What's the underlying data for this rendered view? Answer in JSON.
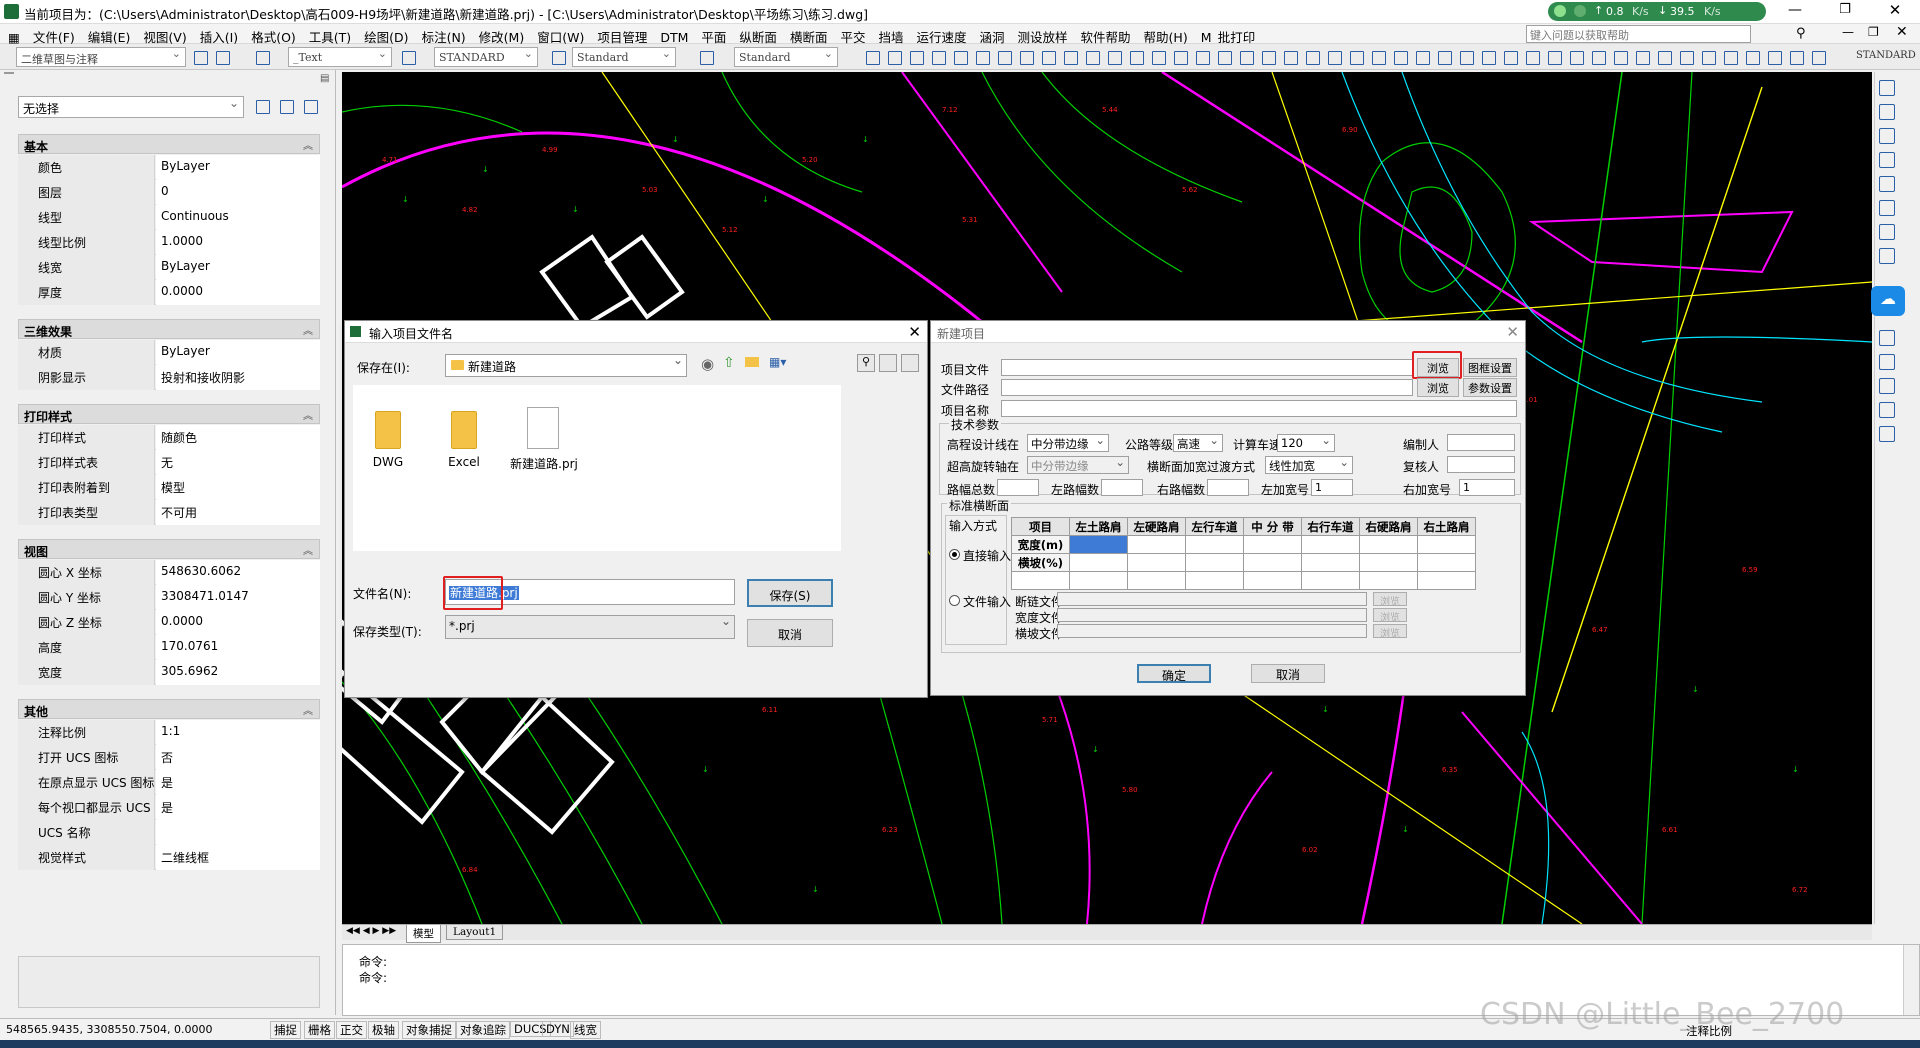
{
  "window": {
    "title": "当前项目为：(C:\\Users\\Administrator\\Desktop\\高石009-H9场坪\\新建道路\\新建道路.prj) - [C:\\Users\\Administrator\\Desktop\\平场练习\\练习.dwg]",
    "net_up": "0.8",
    "net_up_unit": "K/s",
    "net_down": "39.5",
    "net_down_unit": "K/s",
    "help_search_placeholder": "键入问题以获取帮助"
  },
  "menu": [
    "文件(F)",
    "编辑(E)",
    "视图(V)",
    "插入(I)",
    "格式(O)",
    "工具(T)",
    "绘图(D)",
    "标注(N)",
    "修改(M)",
    "窗口(W)",
    "项目管理",
    "DTM",
    "平面",
    "纵断面",
    "横断面",
    "平交",
    "挡墙",
    "运行速度",
    "涵洞",
    "测设放样",
    "软件帮助",
    "帮助(H)",
    "M_批打印"
  ],
  "toolbar": {
    "workspace": "二维草图与注释",
    "text_style": "_Text",
    "dim_style": "STANDARD",
    "table_style": "Standard",
    "multileader_style": "Standard",
    "right_style": "STANDARD"
  },
  "properties": {
    "selection": "无选择",
    "sections": [
      {
        "title": "基本",
        "rows": [
          [
            "颜色",
            "ByLayer"
          ],
          [
            "图层",
            "0"
          ],
          [
            "线型",
            "Continuous"
          ],
          [
            "线型比例",
            "1.0000"
          ],
          [
            "线宽",
            "ByLayer"
          ],
          [
            "厚度",
            "0.0000"
          ]
        ]
      },
      {
        "title": "三维效果",
        "rows": [
          [
            "材质",
            "ByLayer"
          ],
          [
            "阴影显示",
            "投射和接收阴影"
          ]
        ]
      },
      {
        "title": "打印样式",
        "rows": [
          [
            "打印样式",
            "随颜色"
          ],
          [
            "打印样式表",
            "无"
          ],
          [
            "打印表附着到",
            "模型"
          ],
          [
            "打印表类型",
            "不可用"
          ]
        ]
      },
      {
        "title": "视图",
        "rows": [
          [
            "圆心 X 坐标",
            "548630.6062"
          ],
          [
            "圆心 Y 坐标",
            "3308471.0147"
          ],
          [
            "圆心 Z 坐标",
            "0.0000"
          ],
          [
            "高度",
            "170.0761"
          ],
          [
            "宽度",
            "305.6962"
          ]
        ]
      },
      {
        "title": "其他",
        "rows": [
          [
            "注释比例",
            "1:1"
          ],
          [
            "打开 UCS 图标",
            "否"
          ],
          [
            "在原点显示 UCS 图标",
            "是"
          ],
          [
            "每个视口都显示 UCS",
            "是"
          ],
          [
            "UCS 名称",
            ""
          ],
          [
            "视觉样式",
            "二维线框"
          ]
        ]
      }
    ]
  },
  "save_dialog": {
    "title": "输入项目文件名",
    "save_in_label": "保存在(I):",
    "save_in_value": "新建道路",
    "files": [
      {
        "name": "DWG",
        "kind": "folder"
      },
      {
        "name": "Excel",
        "kind": "folder"
      },
      {
        "name": "新建道路.prj",
        "kind": "file"
      }
    ],
    "filename_label": "文件名(N):",
    "filename_value": "新建道路.prj",
    "filetype_label": "保存类型(T):",
    "filetype_value": "*.prj",
    "save_button": "保存(S)",
    "cancel_button": "取消"
  },
  "new_project": {
    "title": "新建项目",
    "project_file_label": "项目文件",
    "file_path_label": "文件路径",
    "project_name_label": "项目名称",
    "browse1": "浏览",
    "frame_setting": "图框设置",
    "browse2": "浏览",
    "param_setting": "参数设置",
    "tech_params_label": "技术参数",
    "elev_line_label": "高程设计线在",
    "elev_line_value": "中分带边缘",
    "grade_label": "公路等级",
    "grade_value": "高速",
    "speed_label": "计算车速",
    "speed_value": "120",
    "editor_label": "编制人",
    "super_axis_label": "超高旋转轴在",
    "super_axis_value": "中分带边缘",
    "widen_label": "横断面加宽过渡方式",
    "widen_value": "线性加宽",
    "reviewer_label": "复核人",
    "total_width_label": "路幅总数",
    "left_width_label": "左路幅数",
    "right_width_label": "右路幅数",
    "left_add_label": "左加宽号",
    "left_add_value": "1",
    "right_add_label": "右加宽号",
    "right_add_value": "1",
    "std_section_label": "标准横断面",
    "input_mode_label": "输入方式",
    "direct_input": "直接输入",
    "file_input": "文件输入",
    "grid_headers": [
      "项目",
      "左土路肩",
      "左硬路肩",
      "左行车道",
      "中 分 带",
      "右行车道",
      "右硬路肩",
      "右土路肩"
    ],
    "grid_rows": [
      "宽度(m)",
      "横坡(%)"
    ],
    "chain_file_label": "断链文件",
    "width_file_label": "宽度文件",
    "slope_file_label": "横坡文件",
    "browse_label": "浏览",
    "ok_button": "确定",
    "cancel_button": "取消"
  },
  "layout_tabs": [
    "模型",
    "Layout1"
  ],
  "command_lines": [
    "命令:",
    "命令:"
  ],
  "status": {
    "coords": "548565.9435, 3308550.7504, 0.0000",
    "toggles": [
      "捕捉",
      "栅格",
      "正交",
      "极轴",
      "对象捕捉",
      "对象追踪",
      "DUCS",
      "DYN",
      "线宽"
    ],
    "annotation_scale": "注释比例",
    "watermark": "CSDN @Little_Bee_2700"
  },
  "colors": {
    "canvas": "#000000",
    "magenta": "#ff00ff",
    "green": "#00d000",
    "yellow": "#ffff00",
    "cyan": "#00e5ff",
    "red_text": "#ff2020",
    "highlight": "#e02020",
    "selection": "#3d7bd6"
  }
}
